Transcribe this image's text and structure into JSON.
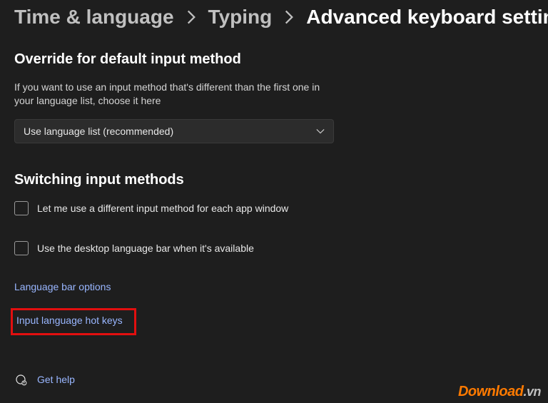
{
  "breadcrumb": {
    "level1": "Time & language",
    "level2": "Typing",
    "current": "Advanced keyboard settings"
  },
  "override": {
    "heading": "Override for default input method",
    "description": "If you want to use an input method that's different than the first one in your language list, choose it here",
    "dropdown_value": "Use language list (recommended)"
  },
  "switching": {
    "heading": "Switching input methods",
    "checkbox1_label": "Let me use a different input method for each app window",
    "checkbox2_label": "Use the desktop language bar when it's available"
  },
  "links": {
    "language_bar_options": "Language bar options",
    "hot_keys": "Input language hot keys"
  },
  "help": {
    "label": "Get help"
  },
  "watermark": {
    "p1": "Download",
    "p2": ".vn"
  }
}
